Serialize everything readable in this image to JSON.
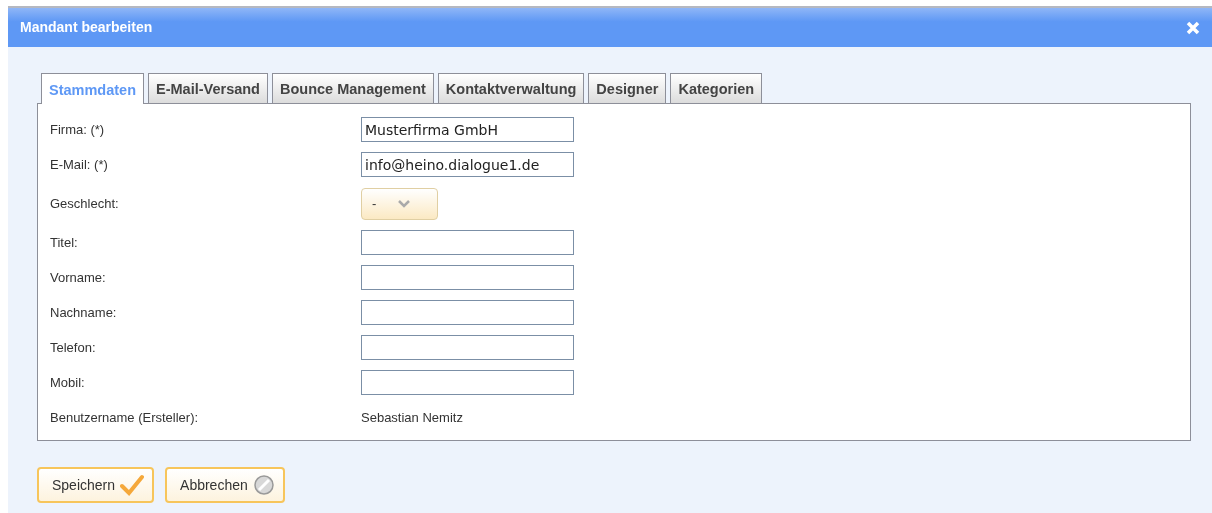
{
  "window": {
    "title": "Mandant bearbeiten"
  },
  "tabs": [
    {
      "label": "Stammdaten",
      "selected": true
    },
    {
      "label": "E-Mail-Versand",
      "selected": false
    },
    {
      "label": "Bounce Management",
      "selected": false
    },
    {
      "label": "Kontaktverwaltung",
      "selected": false
    },
    {
      "label": "Designer",
      "selected": false
    },
    {
      "label": "Kategorien",
      "selected": false
    }
  ],
  "fields": [
    {
      "kind": "text",
      "label": "Firma: (*)",
      "value": "Musterfirma GmbH"
    },
    {
      "kind": "text",
      "label": "E-Mail: (*)",
      "value": "info@heino.dialogue1.de"
    },
    {
      "kind": "select",
      "label": "Geschlecht:",
      "value": "-"
    },
    {
      "kind": "text",
      "label": "Titel:"
    },
    {
      "kind": "text",
      "label": "Vorname:"
    },
    {
      "kind": "text",
      "label": "Nachname:"
    },
    {
      "kind": "text",
      "label": "Telefon:"
    },
    {
      "kind": "text",
      "label": "Mobil:"
    },
    {
      "kind": "static",
      "label": "Benutzername (Ersteller):",
      "value": "Sebastian Nemitz"
    }
  ],
  "buttons": [
    {
      "kind": "save",
      "label": "Speichern"
    },
    {
      "kind": "cancel",
      "label": "Abbrechen"
    }
  ]
}
